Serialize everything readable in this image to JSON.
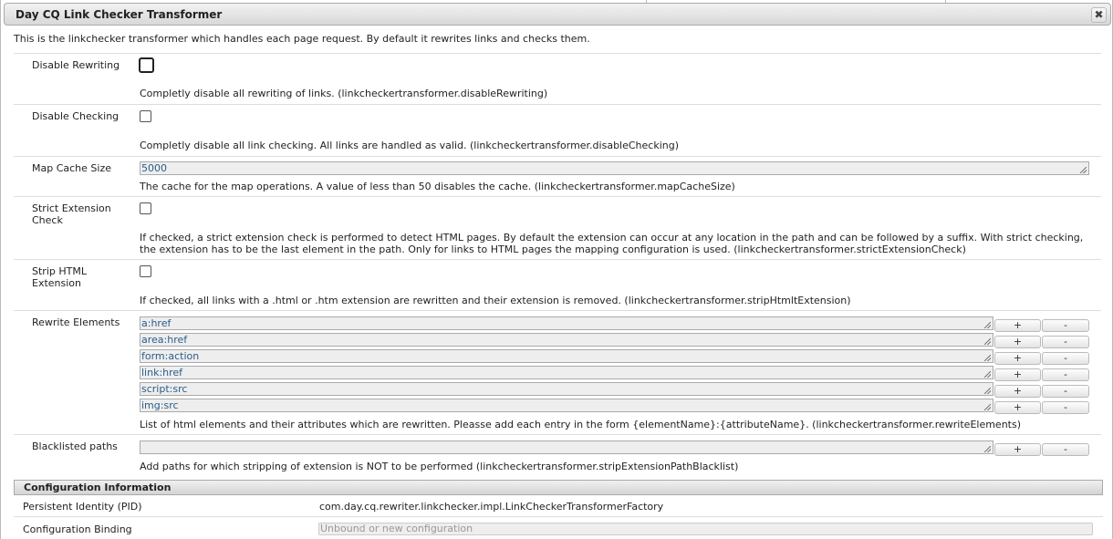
{
  "dialog": {
    "title": "Day CQ Link Checker Transformer",
    "close_label": "✖",
    "description": "This is the linkchecker transformer which handles each page request. By default it rewrites links and checks them."
  },
  "fields": {
    "disable_rewriting": {
      "label": "Disable Rewriting",
      "checked": false,
      "help": "Completly disable all rewriting of links. (linkcheckertransformer.disableRewriting)"
    },
    "disable_checking": {
      "label": "Disable Checking",
      "checked": false,
      "help": "Completly disable all link checking. All links are handled as valid. (linkcheckertransformer.disableChecking)"
    },
    "map_cache_size": {
      "label": "Map Cache Size",
      "value": "5000",
      "help": "The cache for the map operations. A value of less than 50 disables the cache. (linkcheckertransformer.mapCacheSize)"
    },
    "strict_extension_check": {
      "label": "Strict Extension Check",
      "checked": false,
      "help": "If checked, a strict extension check is performed to detect HTML pages. By default the extension can occur at any location in the path and can be followed by a suffix. With strict checking, the extension has to be the last element in the path. Only for links to HTML pages the mapping configuration is used. (linkcheckertransformer.strictExtensionCheck)"
    },
    "strip_html_extension": {
      "label": "Strip HTML Extension",
      "checked": false,
      "help": "If checked, all links with a .html or .htm extension are rewritten and their extension is removed. (linkcheckertransformer.stripHtmltExtension)"
    },
    "rewrite_elements": {
      "label": "Rewrite Elements",
      "values": [
        "a:href",
        "area:href",
        "form:action",
        "link:href",
        "script:src",
        "img:src"
      ],
      "add_label": "+",
      "remove_label": "-",
      "help": "List of html elements and their attributes which are rewritten. Pleasse add each entry in the form {elementName}:{attributeName}. (linkcheckertransformer.rewriteElements)"
    },
    "blacklisted_paths": {
      "label": "Blacklisted paths",
      "value": "",
      "add_label": "+",
      "remove_label": "-",
      "help": "Add paths for which stripping of extension is NOT to be performed (linkcheckertransformer.stripExtensionPathBlacklist)"
    }
  },
  "config_info": {
    "title": "Configuration Information",
    "pid_label": "Persistent Identity (PID)",
    "pid_value": "com.day.cq.rewriter.linkchecker.impl.LinkCheckerTransformerFactory",
    "binding_label": "Configuration Binding",
    "binding_value": "Unbound or new configuration"
  }
}
